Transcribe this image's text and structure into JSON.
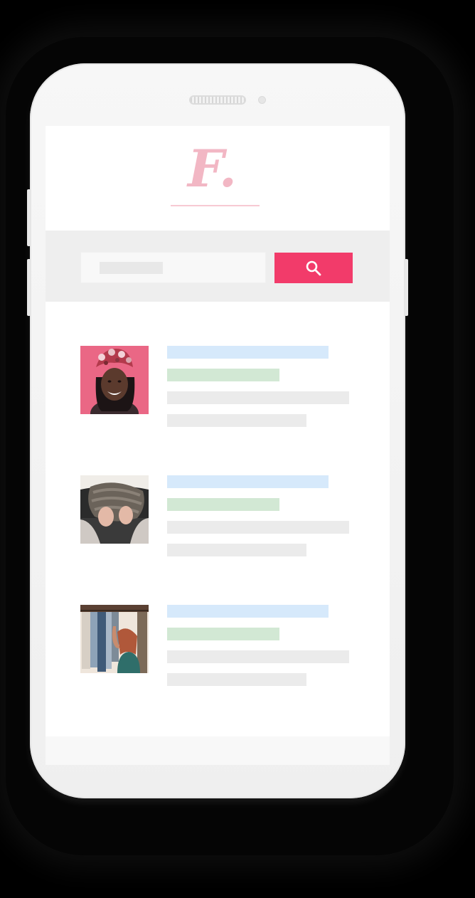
{
  "app": {
    "logo_text": "F.",
    "accent_color": "#f23b6a",
    "logo_color": "#f2b7c4"
  },
  "search": {
    "placeholder": "",
    "button_icon": "search-icon"
  },
  "results": [
    {
      "thumbnail": "portrait-woman-floral-headwrap",
      "title_color": "#d6e9fb",
      "tag_color": "#d2e8d4"
    },
    {
      "thumbnail": "hands-holding-knit-scarf",
      "title_color": "#d6e9fb",
      "tag_color": "#d2e8d4"
    },
    {
      "thumbnail": "woman-browsing-clothes-rack",
      "title_color": "#d6e9fb",
      "tag_color": "#d2e8d4"
    }
  ]
}
